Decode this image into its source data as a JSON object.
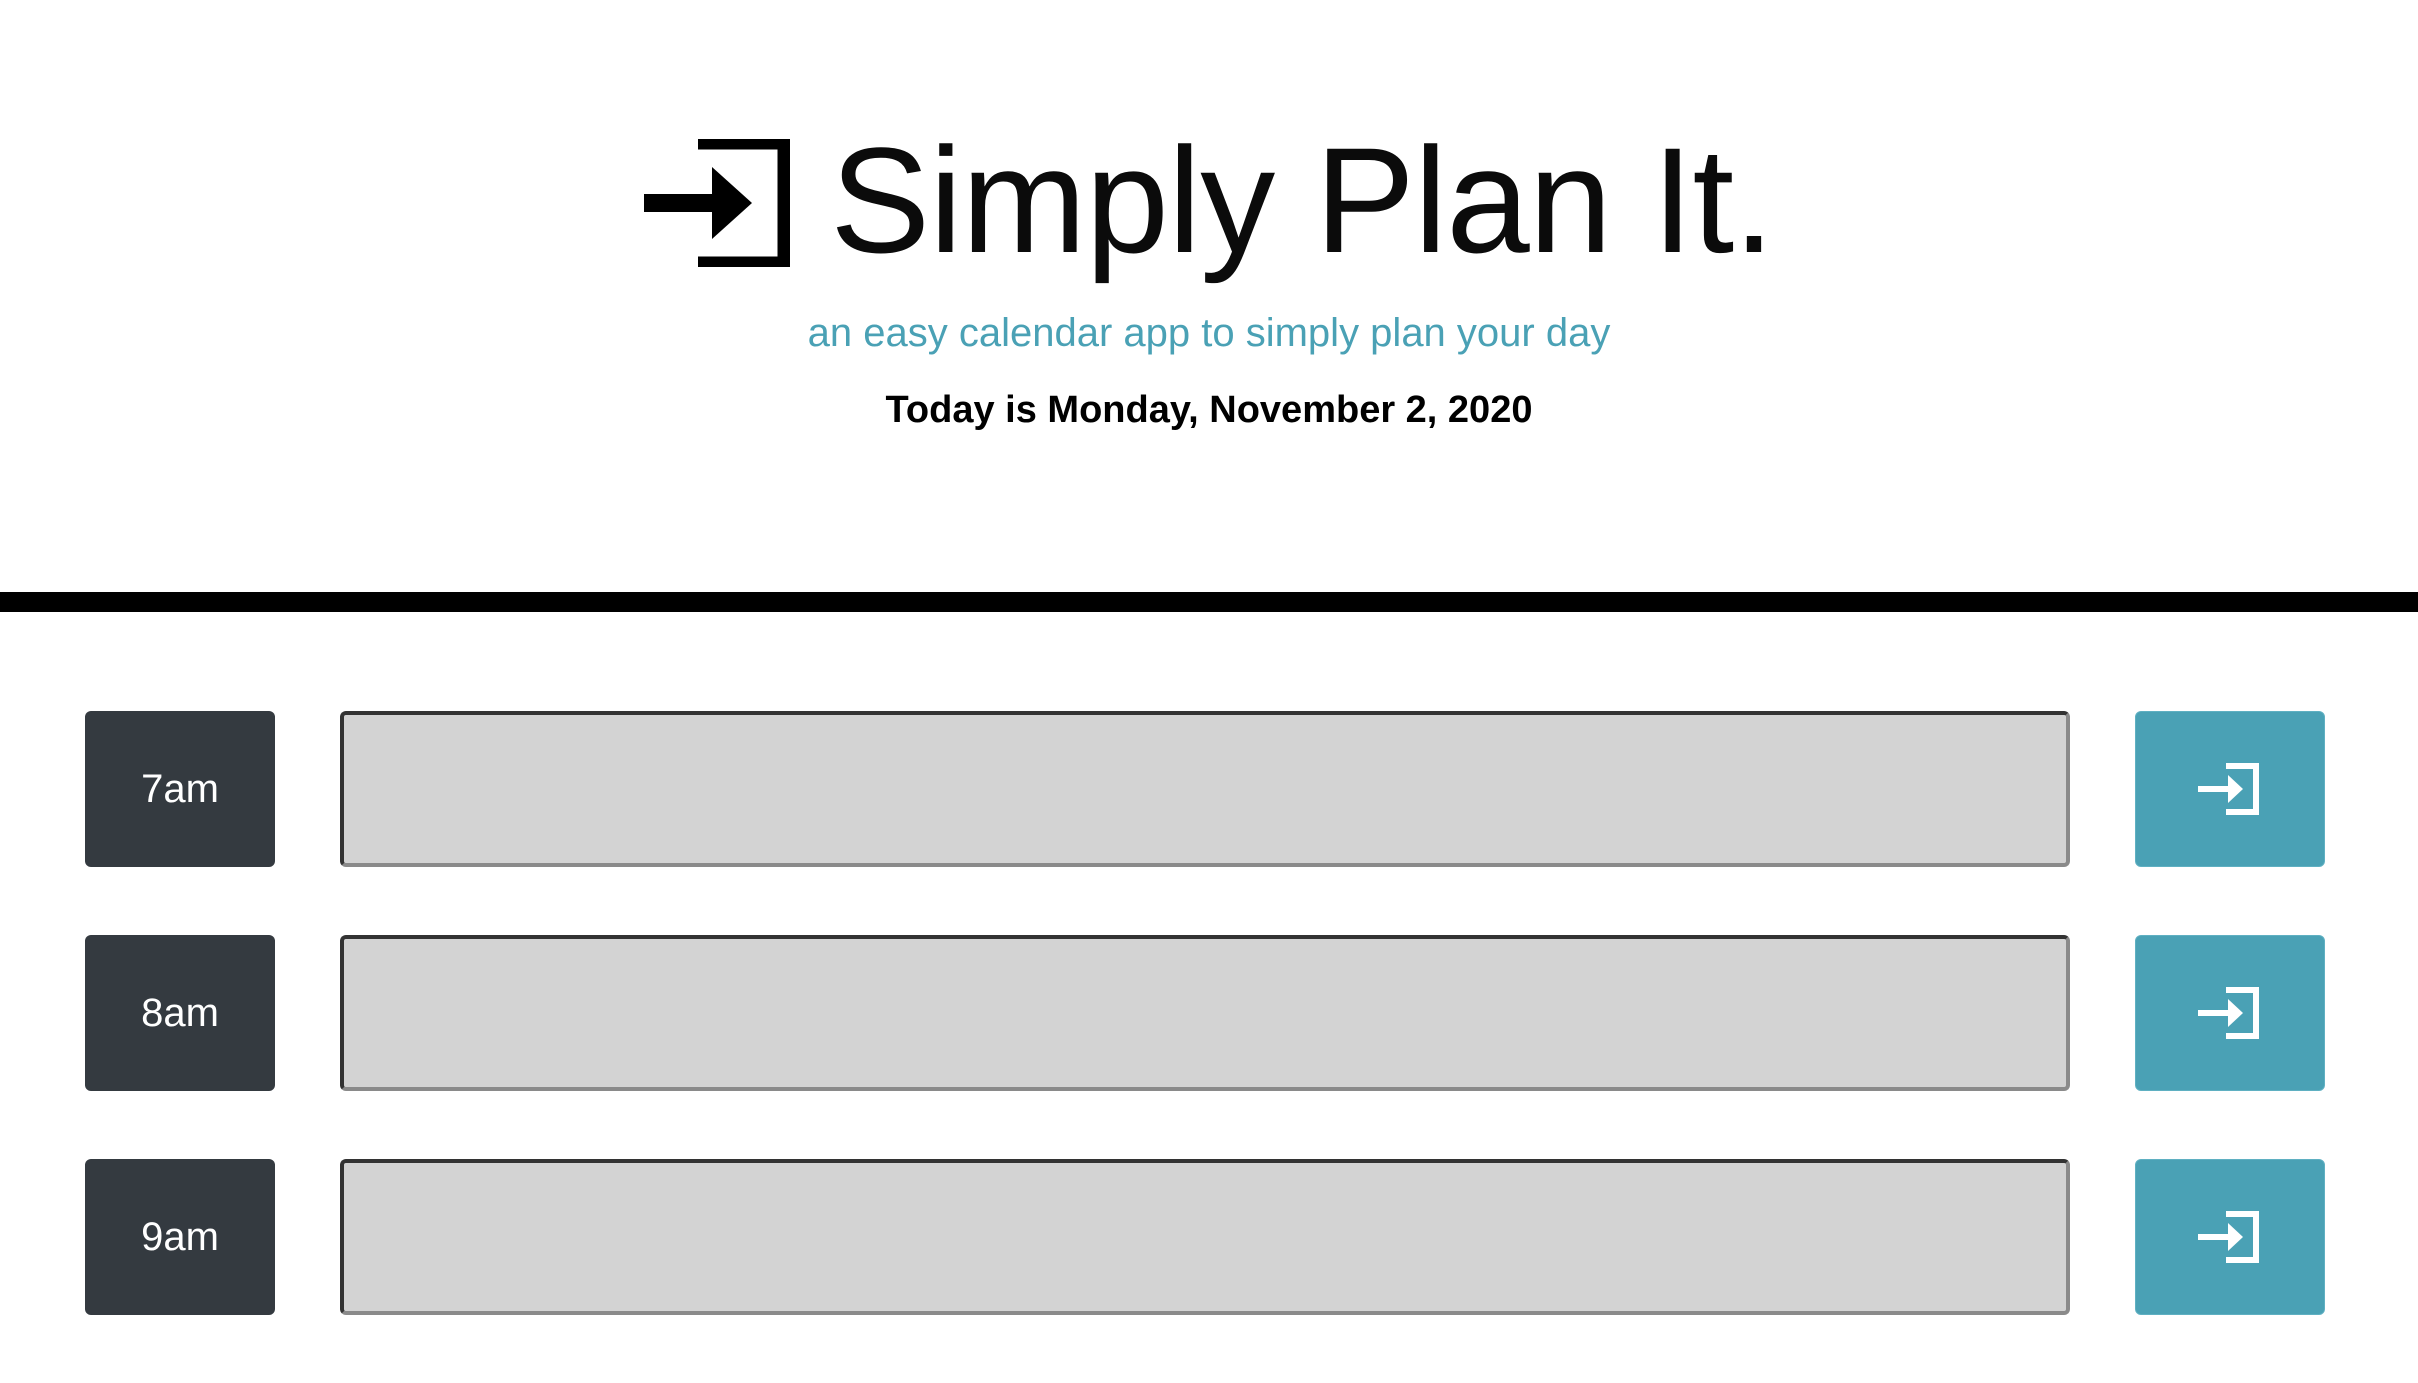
{
  "header": {
    "logo_icon": "sign-in-icon",
    "title": "Simply Plan It.",
    "tagline": "an easy calendar app to simply plan your day",
    "today": "Today is Monday, November 2, 2020"
  },
  "colors": {
    "accent": "#4aa1b5",
    "hour_block": "#343a40",
    "task_bg": "#d3d3d3",
    "divider": "#000000"
  },
  "schedule": {
    "rows": [
      {
        "hour": "7am",
        "task_value": "",
        "save_icon": "save-icon"
      },
      {
        "hour": "8am",
        "task_value": "",
        "save_icon": "save-icon"
      },
      {
        "hour": "9am",
        "task_value": "",
        "save_icon": "save-icon"
      }
    ]
  }
}
